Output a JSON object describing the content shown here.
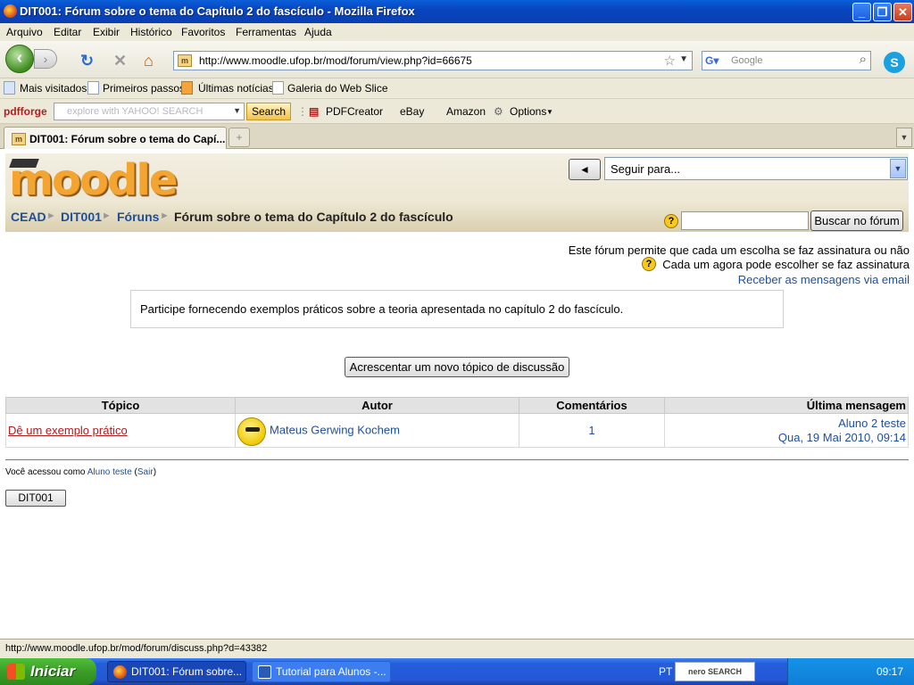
{
  "window": {
    "title": "DIT001: Fórum sobre o tema do Capítulo 2 do fascículo - Mozilla Firefox",
    "min_glyph": "_",
    "max_glyph": "❐",
    "close_glyph": "✕"
  },
  "menu": [
    "Arquivo",
    "Editar",
    "Exibir",
    "Histórico",
    "Favoritos",
    "Ferramentas",
    "Ajuda"
  ],
  "nav": {
    "url": "http://www.moodle.ufop.br/mod/forum/view.php?id=66675",
    "search_placeholder": "Google"
  },
  "bookmarks": [
    "Mais visitados",
    "Primeiros passos",
    "Últimas notícias",
    "Galeria do Web Slice"
  ],
  "toolbar2": {
    "pdfforge": "pdfforge",
    "yahoo_placeholder": "explore with YAHOO! SEARCH",
    "search_label": "Search",
    "pdfcreator": "PDFCreator",
    "ebay": "eBay",
    "amazon": "Amazon",
    "options": "Options"
  },
  "tab": {
    "label": "DIT001: Fórum sobre o tema do Capí..."
  },
  "page": {
    "logo": "moodle",
    "jump_button": "◄",
    "jump_select": "Seguir para...",
    "breadcrumb": [
      "CEAD",
      "DIT001",
      "Fóruns",
      "Fórum sobre o tema do Capítulo 2 do fascículo"
    ],
    "forum_search_button": "Buscar no fórum",
    "subscription_info": "Este fórum permite que cada um escolha se faz assinatura ou não",
    "subscription_choice": "Cada um agora pode escolher se faz assinatura",
    "email_link": "Receber as mensagens via email",
    "intro": "Participe fornecendo exemplos práticos sobre a teoria apresentada no capítulo 2 do fascículo.",
    "add_topic_button": "Acrescentar um novo tópico de discussão",
    "table": {
      "headers": [
        "Tópico",
        "Autor",
        "Comentários",
        "Última mensagem"
      ],
      "rows": [
        {
          "topic": "Dê um exemplo prático",
          "author": "Mateus Gerwing Kochem",
          "comments": "1",
          "last_author": "Aluno 2 teste",
          "last_date": "Qua, 19 Mai 2010, 09:14"
        }
      ]
    },
    "login_prefix": "Você acessou como ",
    "login_user": "Aluno teste",
    "login_logout": "Sair",
    "course_button": "DIT001"
  },
  "status": "http://www.moodle.ufop.br/mod/forum/discuss.php?d=43382",
  "taskbar": {
    "start": "Iniciar",
    "items": [
      "DIT001: Fórum sobre...",
      "Tutorial para Alunos -..."
    ],
    "lang": "PT",
    "nero": "nero SEARCH",
    "clock": "09:17"
  }
}
